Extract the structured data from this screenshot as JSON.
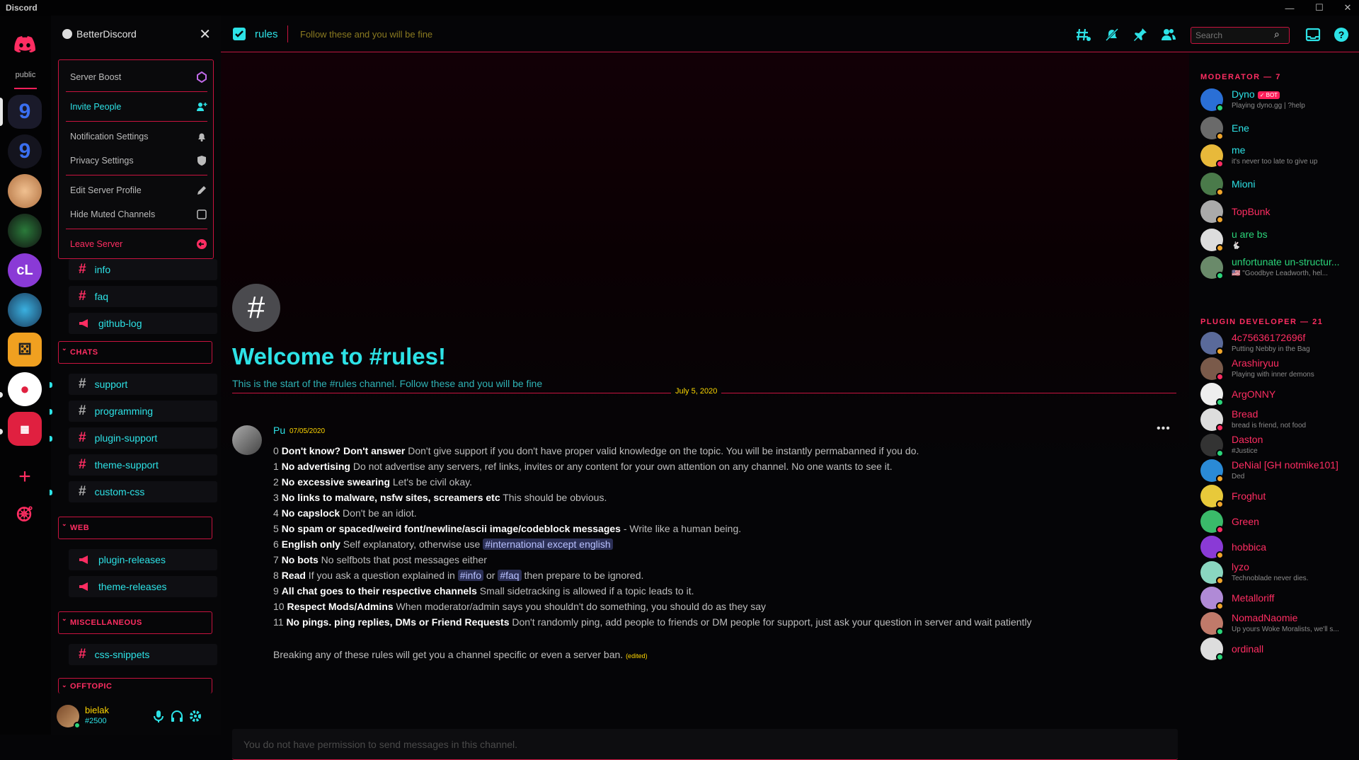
{
  "window": {
    "title": "Discord",
    "minimize": "—",
    "maximize": "☐",
    "close": "✕"
  },
  "rail": {
    "home_label": "public"
  },
  "server": {
    "name": "BetterDiscord"
  },
  "menu": {
    "items": [
      {
        "label": "Server Boost",
        "color": "#bbbbbb"
      },
      {
        "label": "Invite People",
        "color": "#2de2e6"
      },
      {
        "label": "Notification Settings",
        "color": "#bbbbbb"
      },
      {
        "label": "Privacy Settings",
        "color": "#bbbbbb"
      },
      {
        "label": "Edit Server Profile",
        "color": "#bbbbbb"
      },
      {
        "label": "Hide Muted Channels",
        "color": "#bbbbbb"
      },
      {
        "label": "Leave Server",
        "color": "#ff2d62"
      }
    ]
  },
  "channels": {
    "info": "info",
    "faq": "faq",
    "github_log": "github-log",
    "chats_cat": "CHATS",
    "support": "support",
    "programming": "programming",
    "plugin_support": "plugin-support",
    "theme_support": "theme-support",
    "custom_css": "custom-css",
    "web_cat": "WEB",
    "plugin_releases": "plugin-releases",
    "theme_releases": "theme-releases",
    "misc_cat": "MISCELLANEOUS",
    "css_snippets": "css-snippets",
    "offtopic_cat": "OFFTOPIC"
  },
  "user": {
    "name": "bielak",
    "tag": "#2500"
  },
  "header": {
    "channel": "rules",
    "topic": "Follow these and you will be fine",
    "search_placeholder": "Search"
  },
  "chat": {
    "welcome_title": "Welcome to #rules!",
    "welcome_sub": "This is the start of the #rules channel. Follow these and you will be fine",
    "date": "July 5, 2020",
    "author": "Pu",
    "timestamp": "07/05/2020",
    "composer": "You do not have permission to send messages in this channel.",
    "rules": [
      {
        "n": "0",
        "t": "Don't know? Don't answer",
        "d": " Don't give support if you don't have proper valid knowledge on the topic. You will be instantly permabanned if you do."
      },
      {
        "n": "1",
        "t": "No advertising",
        "d": " Do not advertise any servers, ref links, invites or any content for your own attention on any channel. No one wants to see it."
      },
      {
        "n": "2",
        "t": "No excessive swearing",
        "d": " Let's be civil okay."
      },
      {
        "n": "3",
        "t": "No links to malware, nsfw sites, screamers etc",
        "d": " This should be obvious."
      },
      {
        "n": "4",
        "t": "No capslock",
        "d": " Don't be an idiot."
      },
      {
        "n": "5",
        "t": "No spam or spaced/weird font/newline/ascii image/codeblock messages",
        "d": " - Write like a human being."
      },
      {
        "n": "6",
        "t": "English only",
        "d": " Self explanatory, otherwise use ",
        "m": "#international except english"
      },
      {
        "n": "7",
        "t": "No bots",
        "d": " No selfbots that post messages either"
      },
      {
        "n": "8",
        "t": "Read",
        "d": " If you ask a question explained in ",
        "m": "#info",
        "d2": " or ",
        "m2": "#faq",
        "d3": " then prepare to be ignored."
      },
      {
        "n": "9",
        "t": "All chat goes to their respective channels",
        "d": " Small sidetracking is allowed if a topic leads to it."
      },
      {
        "n": "10",
        "t": "Respect Mods/Admins",
        "d": " When moderator/admin says you shouldn't do something, you should do as they say"
      },
      {
        "n": "11",
        "t": "No pings. ping replies, DMs or Friend Requests",
        "d": " Don't randomly ping, add people to friends or DM people for support, just ask your question in server and wait patiently"
      }
    ],
    "footer": "Breaking any of these rules will get you a channel specific or even a server ban.",
    "edited": "(edited)"
  },
  "members": {
    "moderator_cat": "MODERATOR — 7",
    "plugin_cat": "PLUGIN DEVELOPER — 21",
    "bot_tag": "✓ BOT",
    "moderators": [
      {
        "name": "Dyno",
        "activity": "Playing dyno.gg | ?help",
        "color": "#2de2e6",
        "status": "#2bd57a",
        "av": "#2a6fd6"
      },
      {
        "name": "Ene",
        "activity": "",
        "color": "#2de2e6",
        "status": "#f0a52b",
        "av": "#6a6a6a"
      },
      {
        "name": "me",
        "activity": "it's never too late to give up",
        "color": "#2de2e6",
        "status": "#ff2d62",
        "av": "#e8b93a"
      },
      {
        "name": "Mioni",
        "activity": "",
        "color": "#2de2e6",
        "status": "#f0a52b",
        "av": "#4a7a4a"
      },
      {
        "name": "TopBunk",
        "activity": "",
        "color": "#ff2d62",
        "status": "#f0a52b",
        "av": "#aaa"
      },
      {
        "name": "u are bs",
        "activity": "🐇",
        "color": "#2bd57a",
        "status": "#f0a52b",
        "av": "#ddd"
      },
      {
        "name": "unfortunate un-structur...",
        "activity": "🇺🇸 \"Goodbye Leadworth, hel...",
        "color": "#2bd57a",
        "status": "#2bd57a",
        "av": "#6a8a6a"
      }
    ],
    "plugins": [
      {
        "name": "4c75636172696f",
        "activity": "Putting Nebby in the Bag",
        "color": "#ff2d62",
        "status": "#f0a52b",
        "av": "#5a6a9a"
      },
      {
        "name": "Arashiryuu",
        "activity": "Playing with inner demons",
        "color": "#ff2d62",
        "status": "#ff2d62",
        "av": "#7a5a4a"
      },
      {
        "name": "ArgONNY",
        "activity": "",
        "color": "#ff2d62",
        "status": "#2bd57a",
        "av": "#eee"
      },
      {
        "name": "Bread",
        "activity": "bread is friend, not food",
        "color": "#ff2d62",
        "status": "#ff2d62",
        "av": "#ddd"
      },
      {
        "name": "Daston",
        "activity": "#Justice",
        "color": "#ff2d62",
        "status": "#2bd57a",
        "av": "#333"
      },
      {
        "name": "DeNial [GH notmike101]",
        "activity": "Ded",
        "color": "#ff2d62",
        "status": "#f0a52b",
        "av": "#2a8ad6"
      },
      {
        "name": "Froghut",
        "activity": "",
        "color": "#ff2d62",
        "status": "#f0a52b",
        "av": "#e8c93a"
      },
      {
        "name": "Green",
        "activity": "",
        "color": "#ff2d62",
        "status": "#ff2d62",
        "av": "#3aba6a"
      },
      {
        "name": "hobbica",
        "activity": "",
        "color": "#ff2d62",
        "status": "#f0a52b",
        "av": "#8a3ad6"
      },
      {
        "name": "lyzo",
        "activity": "Technoblade never dies.",
        "color": "#ff2d62",
        "status": "#f0a52b",
        "av": "#8ad6c0"
      },
      {
        "name": "Metalloriff",
        "activity": "",
        "color": "#ff2d62",
        "status": "#f0a52b",
        "av": "#b08ad6"
      },
      {
        "name": "NomadNaomie",
        "activity": "Up yours Woke Moralists, we'll s...",
        "color": "#ff2d62",
        "status": "#2bd57a",
        "av": "#c07a6a"
      },
      {
        "name": "ordinall",
        "activity": "",
        "color": "#ff2d62",
        "status": "#2bd57a",
        "av": "#ddd"
      }
    ]
  },
  "colors": {
    "accent": "#ff2d62",
    "cyan": "#2de2e6",
    "yellow": "#ffd600"
  }
}
